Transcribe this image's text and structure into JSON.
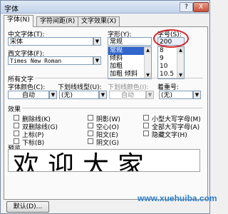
{
  "window": {
    "title": "字体",
    "help_label": "?",
    "close_label": "X"
  },
  "tabs": [
    {
      "label": "字体(N)"
    },
    {
      "label": "字符间距(R)"
    },
    {
      "label": "文字效果(X)"
    }
  ],
  "font": {
    "chinese_label": "中文字体(T):",
    "chinese_value": "宋体",
    "western_label": "西文字体(F):",
    "western_value": "Times New Roman"
  },
  "style": {
    "label": "字形(Y):",
    "value": "常规",
    "items": [
      "常规",
      "倾斜",
      "加粗",
      "加粗 倾斜"
    ],
    "selected_index": 0
  },
  "size": {
    "label": "字号(S):",
    "value": "200",
    "items": [
      "8",
      "9",
      "10",
      "10.5",
      "11"
    ]
  },
  "all_text": {
    "section": "所有文字",
    "color_label": "字体颜色(C):",
    "color_value": "自动",
    "underline_label": "下划线线型(U):",
    "underline_value": "(无)",
    "underline_color_label": "下划线颜色(I):",
    "underline_color_value": "自动",
    "emphasis_label": "着重号:",
    "emphasis_value": "(无)"
  },
  "effects": {
    "section": "效果",
    "items": [
      "删除线(K)",
      "阴影(W)",
      "小型大写字母(M)",
      "双删除线(G)",
      "空心(O)",
      "全部大写字母(A)",
      "上标(P)",
      "阳文(E)",
      "隐藏文字(H)",
      "下标(B)",
      "阴文(G)"
    ]
  },
  "preview": {
    "section": "预览",
    "text": "欢迎大家"
  },
  "footer": {
    "default_label": "默认(D)...",
    "watermark": "www.xuehuiba.com"
  }
}
